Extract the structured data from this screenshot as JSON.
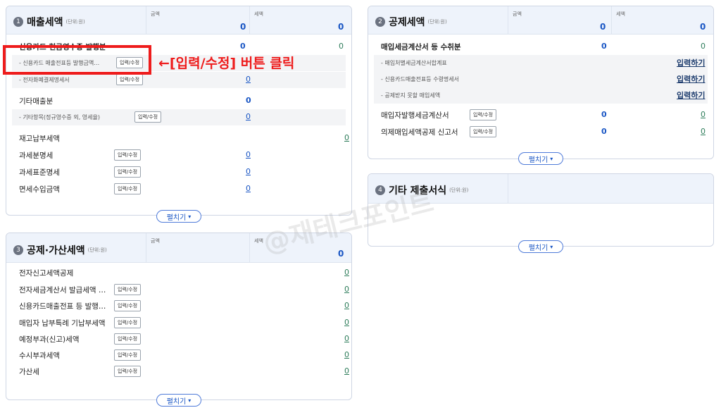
{
  "annotation": {
    "text": "←[입력/수정] 버튼 클릭"
  },
  "watermark": "@재테크포인트",
  "col_labels": {
    "amount": "금액",
    "tax": "세액"
  },
  "common": {
    "input_button": "입력/수정",
    "input_link": "입력하기",
    "expand": "펼치기"
  },
  "panel1": {
    "number": "1",
    "title": "매출세액",
    "unit": "(단위:원)",
    "amount_total": "0",
    "tax_total": "0",
    "rows": [
      {
        "label": "신용카드·현금영수증 발행분",
        "amount": "0",
        "tax": "0"
      },
      {
        "label": "- 신용카드 매출전표등 발행금액…"
      },
      {
        "label": "- 전자화폐결제명세서",
        "value": "0"
      },
      {
        "label": "기타매출분",
        "amount": "0"
      },
      {
        "label": "- 기타항목(정규영수증 외, 영세율)",
        "value": "0"
      },
      {
        "label": "재고납부세액",
        "value": "0"
      },
      {
        "label": "과세분명세",
        "value": "0"
      },
      {
        "label": "과세표준명세",
        "value": "0"
      },
      {
        "label": "면세수입금액",
        "value": "0"
      }
    ]
  },
  "panel2": {
    "number": "2",
    "title": "공제세액",
    "unit": "(단위:원)",
    "amount_total": "0",
    "tax_total": "0",
    "rows": [
      {
        "label": "매입세금계산서 등 수취분",
        "amount": "0",
        "tax": "0"
      },
      {
        "label": "- 매입처별세금계산서합계표"
      },
      {
        "label": "- 신용카드매출전표등 수령명세서"
      },
      {
        "label": "- 공제받지 못할 매입세액"
      },
      {
        "label": "매입자발행세금계산서",
        "amount": "0",
        "value": "0"
      },
      {
        "label": "의제매입세액공제 신고서",
        "amount": "0",
        "value": "0"
      }
    ]
  },
  "panel3": {
    "number": "3",
    "title": "공제·가산세액",
    "unit": "(단위:원)",
    "tax_total": "0",
    "rows": [
      {
        "label": "전자신고세액공제",
        "value": "0"
      },
      {
        "label": "전자세금계산서 발급세액 …",
        "value": "0"
      },
      {
        "label": "신용카드매출전표 등 발행…",
        "value": "0"
      },
      {
        "label": "매입자 납부특례 기납부세액",
        "value": "0"
      },
      {
        "label": "예정부과(신고)세액",
        "value": "0"
      },
      {
        "label": "수시부과세액",
        "value": "0"
      },
      {
        "label": "가산세",
        "value": "0"
      }
    ]
  },
  "panel4": {
    "number": "4",
    "title": "기타 제출서식",
    "unit": "(단위:원)"
  }
}
